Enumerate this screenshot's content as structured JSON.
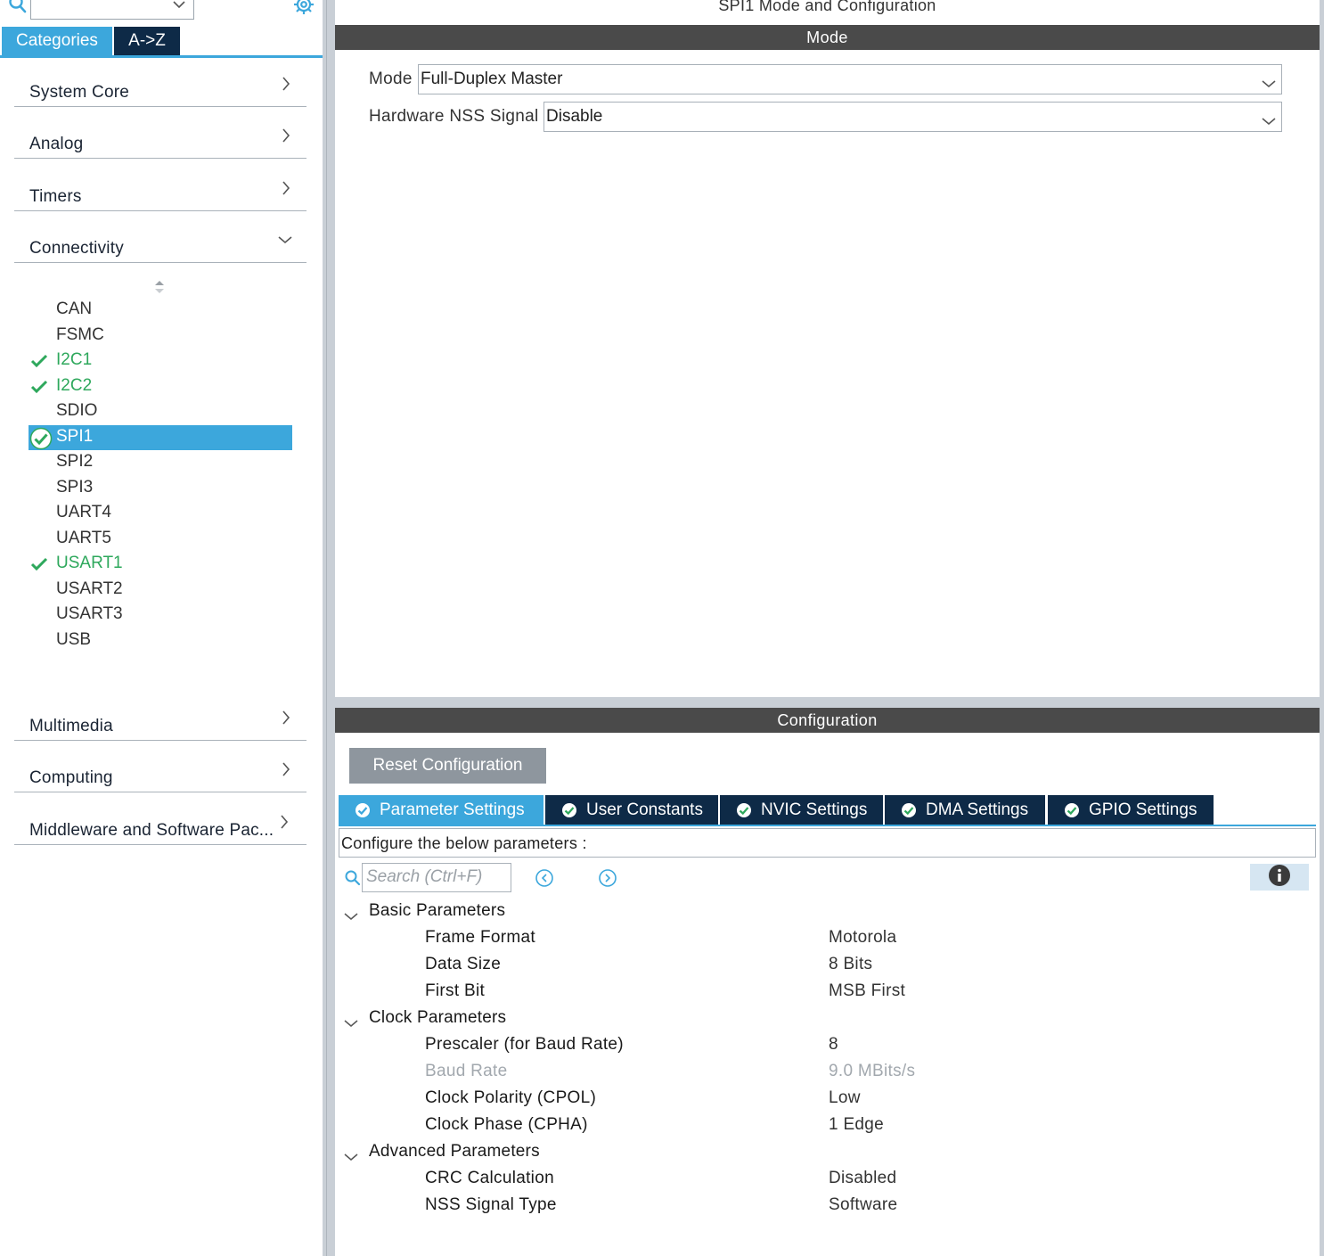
{
  "left_panel": {
    "filter_value": "",
    "tabs": {
      "categories": "Categories",
      "az": "A->Z"
    },
    "categories_top": [
      "System Core",
      "Analog",
      "Timers",
      "Connectivity"
    ],
    "connectivity_items": [
      {
        "label": "CAN",
        "enabled": false,
        "selected": false
      },
      {
        "label": "FSMC",
        "enabled": false,
        "selected": false
      },
      {
        "label": "I2C1",
        "enabled": true,
        "selected": false
      },
      {
        "label": "I2C2",
        "enabled": true,
        "selected": false
      },
      {
        "label": "SDIO",
        "enabled": false,
        "selected": false
      },
      {
        "label": "SPI1",
        "enabled": true,
        "selected": true
      },
      {
        "label": "SPI2",
        "enabled": false,
        "selected": false
      },
      {
        "label": "SPI3",
        "enabled": false,
        "selected": false
      },
      {
        "label": "UART4",
        "enabled": false,
        "selected": false
      },
      {
        "label": "UART5",
        "enabled": false,
        "selected": false
      },
      {
        "label": "USART1",
        "enabled": true,
        "selected": false
      },
      {
        "label": "USART2",
        "enabled": false,
        "selected": false
      },
      {
        "label": "USART3",
        "enabled": false,
        "selected": false
      },
      {
        "label": "USB",
        "enabled": false,
        "selected": false
      }
    ],
    "categories_bottom": [
      "Multimedia",
      "Computing",
      "Middleware and Software Pac..."
    ]
  },
  "mode_panel": {
    "title": "SPI1 Mode and Configuration",
    "section": "Mode",
    "mode_label": "Mode",
    "mode_value": "Full-Duplex Master",
    "nss_label": "Hardware NSS Signal",
    "nss_value": "Disable"
  },
  "config_panel": {
    "section": "Configuration",
    "reset_label": "Reset Configuration",
    "tabs": [
      "Parameter Settings",
      "User Constants",
      "NVIC Settings",
      "DMA Settings",
      "GPIO Settings"
    ],
    "active_tab": "Parameter Settings",
    "configure_text": "Configure the below parameters :",
    "search_placeholder": "Search (Ctrl+F)",
    "groups": [
      {
        "title": "Basic Parameters",
        "params": [
          {
            "name": "Frame Format",
            "value": "Motorola",
            "dim": false
          },
          {
            "name": "Data Size",
            "value": "8 Bits",
            "dim": false
          },
          {
            "name": "First Bit",
            "value": "MSB First",
            "dim": false
          }
        ]
      },
      {
        "title": "Clock Parameters",
        "params": [
          {
            "name": "Prescaler (for Baud Rate)",
            "value": "8",
            "dim": false
          },
          {
            "name": "Baud Rate",
            "value": "9.0 MBits/s",
            "dim": true
          },
          {
            "name": "Clock Polarity (CPOL)",
            "value": "Low",
            "dim": false
          },
          {
            "name": "Clock Phase (CPHA)",
            "value": "1 Edge",
            "dim": false
          }
        ]
      },
      {
        "title": "Advanced Parameters",
        "params": [
          {
            "name": "CRC Calculation",
            "value": "Disabled",
            "dim": false
          },
          {
            "name": "NSS Signal Type",
            "value": "Software",
            "dim": false
          }
        ]
      }
    ]
  },
  "colors": {
    "accent": "#3ca7dc",
    "dark_tab": "#0e2a47",
    "section_bar": "#4a4a4a",
    "enabled_green": "#2ea85c"
  }
}
